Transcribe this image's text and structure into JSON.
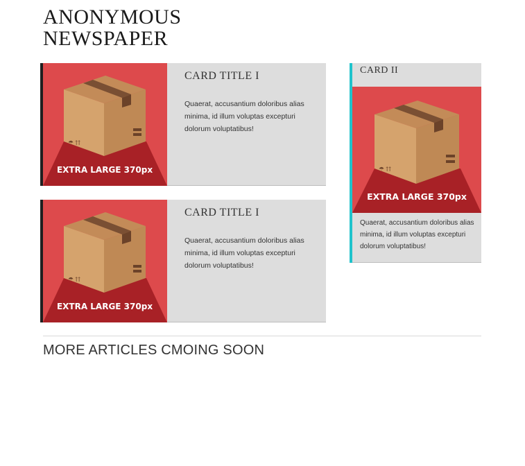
{
  "site": {
    "title_line1": "ANONYMOUS",
    "title_line2": "NEWSPAPER"
  },
  "colors": {
    "accent_dark": "#1f1f1f",
    "accent_cyan": "#1fc3cc",
    "card_bg": "#dddddd",
    "thumb_red": "#dd4a4c",
    "thumb_dark_red": "#a82126",
    "box_tan": "#d5a36d"
  },
  "cards": [
    {
      "title": "CARD TITLE I",
      "text": "Quaerat, accusantium doloribus alias minima, id illum voluptas excepturi dolorum voluptatibus!",
      "image_label": "EXTRA LARGE 370px"
    },
    {
      "title": "CARD TITLE I",
      "text": "Quaerat, accusantium doloribus alias minima, id illum voluptas excepturi dolorum voluptatibus!",
      "image_label": "EXTRA LARGE 370px"
    }
  ],
  "side_card": {
    "title": "CARD II",
    "text": "Quaerat, accusantium doloribus alias minima, id illum voluptas excepturi dolorum voluptatibus!",
    "image_label": "EXTRA LARGE 370px"
  },
  "footer": {
    "more_text": "MORE ARTICLES CMOING SOON"
  }
}
